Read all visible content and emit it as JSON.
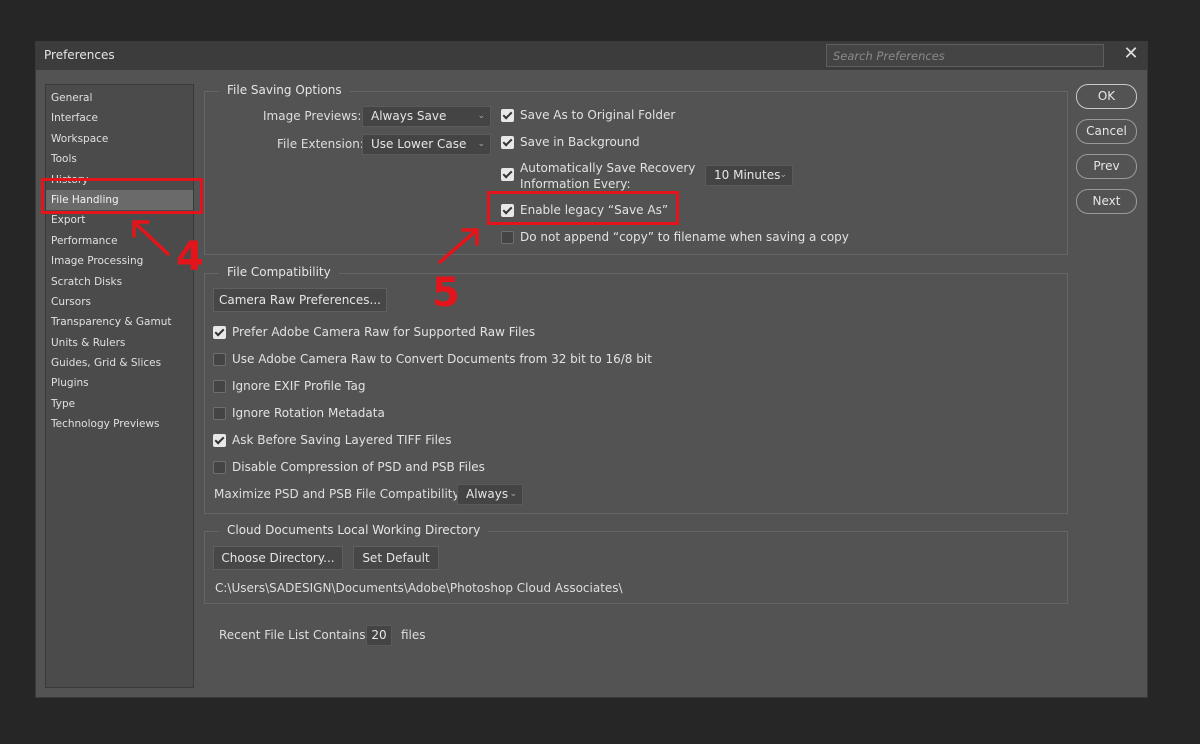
{
  "window": {
    "title": "Preferences",
    "search_placeholder": "Search Preferences",
    "close_glyph": "✕"
  },
  "sidebar": {
    "items": [
      "General",
      "Interface",
      "Workspace",
      "Tools",
      "History",
      "File Handling",
      "Export",
      "Performance",
      "Image Processing",
      "Scratch Disks",
      "Cursors",
      "Transparency & Gamut",
      "Units & Rulers",
      "Guides, Grid & Slices",
      "Plugins",
      "Type",
      "Technology Previews"
    ],
    "selected": "File Handling"
  },
  "file_saving": {
    "title": "File Saving Options",
    "image_previews_label": "Image Previews:",
    "image_previews_value": "Always Save",
    "file_extension_label": "File Extension:",
    "file_extension_value": "Use Lower Case",
    "save_original_folder": {
      "label": "Save As to Original Folder",
      "checked": true
    },
    "save_background": {
      "label": "Save in Background",
      "checked": true
    },
    "auto_save": {
      "label_line1": "Automatically Save Recovery",
      "label_line2": "Information Every:",
      "checked": true
    },
    "auto_save_interval": "10 Minutes",
    "legacy_save_as": {
      "label": "Enable legacy “Save As”",
      "checked": true
    },
    "no_copy_append": {
      "label": "Do not append “copy” to filename when saving a copy",
      "checked": false
    }
  },
  "file_compat": {
    "title": "File Compatibility",
    "camera_raw_button": "Camera Raw Preferences...",
    "options": [
      {
        "label": "Prefer Adobe Camera Raw for Supported Raw Files",
        "checked": true
      },
      {
        "label": "Use Adobe Camera Raw to Convert Documents from 32 bit to 16/8 bit",
        "checked": false
      },
      {
        "label": "Ignore EXIF Profile Tag",
        "checked": false
      },
      {
        "label": "Ignore Rotation Metadata",
        "checked": false
      },
      {
        "label": "Ask Before Saving Layered TIFF Files",
        "checked": true
      },
      {
        "label": "Disable Compression of PSD and PSB Files",
        "checked": false
      }
    ],
    "maximize_label": "Maximize PSD and PSB File Compatibility:",
    "maximize_value": "Always"
  },
  "cloud": {
    "title": "Cloud Documents Local Working Directory",
    "choose_button": "Choose Directory...",
    "default_button": "Set Default",
    "path": "C:\\Users\\SADESIGN\\Documents\\Adobe\\Photoshop Cloud Associates\\"
  },
  "recent": {
    "label": "Recent File List Contains:",
    "value": "20",
    "unit": "files"
  },
  "buttons": {
    "ok": "OK",
    "cancel": "Cancel",
    "prev": "Prev",
    "next": "Next"
  },
  "annotations": {
    "step_a": "4",
    "step_b": "5",
    "color": "#e3151a"
  },
  "icons": {
    "checkbox_checked": "check-icon",
    "dropdown": "chevron-down-icon",
    "close": "close-icon"
  }
}
